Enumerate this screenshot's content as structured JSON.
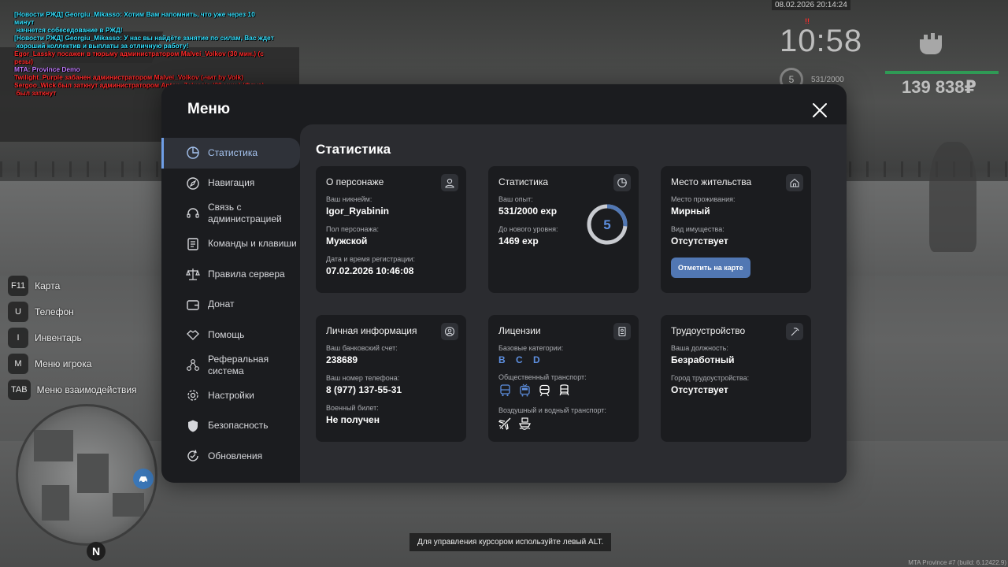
{
  "chat": [
    {
      "color": "#33e0ff",
      "text": "[Новости РЖД] Georgiu_Mikasso: Хотим Вам напомнить, что уже через 10 минут"
    },
    {
      "color": "#33e0ff",
      "text": " начнется собеседование в РЖД!"
    },
    {
      "color": "#33e0ff",
      "text": "[Новости РЖД] Georgiu_Mikasso: У нас вы найдёте занятие по силам, Вас ждет"
    },
    {
      "color": "#33e0ff",
      "text": " хороший коллектив и выплаты за отличную работу!"
    },
    {
      "color": "#ff2b2b",
      "text": "Egor_Lassky посажен в тюрьму администратором Malvei_Volkov (30 мин.) (с"
    },
    {
      "color": "#ff2b2b",
      "text": "резы)"
    },
    {
      "color": "#c27bff",
      "text": "MTA: Province Demo"
    },
    {
      "color": "#ff2b2b",
      "text": "Twilight_Purple забанен администратором Malvei_Volkov (-чит by Volk)"
    },
    {
      "color": "#ff2b2b",
      "text": "Sergoo_Wick был заткнут администратором Anton_Zaluccio (30 мин.) (Флуд)"
    },
    {
      "color": "#ff2b2b",
      "text": " был заткнут"
    }
  ],
  "hud": {
    "datetime": "08.02.2026 20:14:24",
    "time": "10:58",
    "alert": "!!",
    "level": "5",
    "exp": "531/2000",
    "money": "139 838₽",
    "health_color": "#2f9a55"
  },
  "keys": [
    {
      "key": "F11",
      "label": "Карта"
    },
    {
      "key": "U",
      "label": "Телефон"
    },
    {
      "key": "I",
      "label": "Инвентарь"
    },
    {
      "key": "M",
      "label": "Меню игрока"
    },
    {
      "key": "TAB",
      "label": "Меню взаимодействия"
    }
  ],
  "minimap": {
    "north": "N"
  },
  "cursor_hint": "Для управления курсором используйте левый ALT.",
  "build": "MTA Province #7 (build: 6.12422.9)",
  "menu": {
    "title": "Меню",
    "accent": "#6f9ee6",
    "sidebar": [
      {
        "label": "Статистика",
        "icon": "pie-chart-icon",
        "active": true
      },
      {
        "label": "Навигация",
        "icon": "compass-icon"
      },
      {
        "label": "Связь с администрацией",
        "icon": "headset-icon"
      },
      {
        "label": "Команды и клавиши",
        "icon": "document-icon"
      },
      {
        "label": "Правила сервера",
        "icon": "scales-icon"
      },
      {
        "label": "Донат",
        "icon": "wallet-icon"
      },
      {
        "label": "Помощь",
        "icon": "handshake-icon"
      },
      {
        "label": "Реферальная система",
        "icon": "network-icon"
      },
      {
        "label": "Настройки",
        "icon": "gear-icon"
      },
      {
        "label": "Безопасность",
        "icon": "shield-icon"
      },
      {
        "label": "Обновления",
        "icon": "refresh-icon"
      }
    ],
    "content_title": "Статистика",
    "cards": {
      "character": {
        "title": "О персонаже",
        "nick_label": "Ваш никнейм:",
        "nick": "Igor_Ryabinin",
        "gender_label": "Пол персонажа:",
        "gender": "Мужской",
        "reg_label": "Дата и время регистрации:",
        "reg": "07.02.2026 10:46:08"
      },
      "stats": {
        "title": "Статистика",
        "exp_label": "Ваш опыт:",
        "exp": "531/2000 exp",
        "next_label": "До нового уровня:",
        "next": "1469 exp",
        "level": "5",
        "progress": 0.2655,
        "ring_color": "#5177b3"
      },
      "residence": {
        "title": "Место жительства",
        "place_label": "Место проживания:",
        "place": "Мирный",
        "property_label": "Вид имущества:",
        "property": "Отсутствует",
        "button": "Отметить на карте"
      },
      "personal": {
        "title": "Личная информация",
        "bank_label": "Ваш банковский счет:",
        "bank": "238689",
        "phone_label": "Ваш номер телефона:",
        "phone": "8 (977) 137-55-31",
        "military_label": "Военный билет:",
        "military": "Не получен"
      },
      "licenses": {
        "title": "Лицензии",
        "base_label": "Базовые категории:",
        "base": "B C D",
        "public_label": "Общественный транспорт:",
        "public_icons": [
          "bus-icon",
          "trolleybus-icon",
          "tram-icon",
          "train-icon"
        ],
        "air_label": "Воздушный и водный транспорт:",
        "air_icons": [
          "plane-icon",
          "ship-icon"
        ]
      },
      "employment": {
        "title": "Трудоустройство",
        "position_label": "Ваша должность:",
        "position": "Безработный",
        "city_label": "Город трудоустройства:",
        "city": "Отсутствует"
      }
    }
  }
}
